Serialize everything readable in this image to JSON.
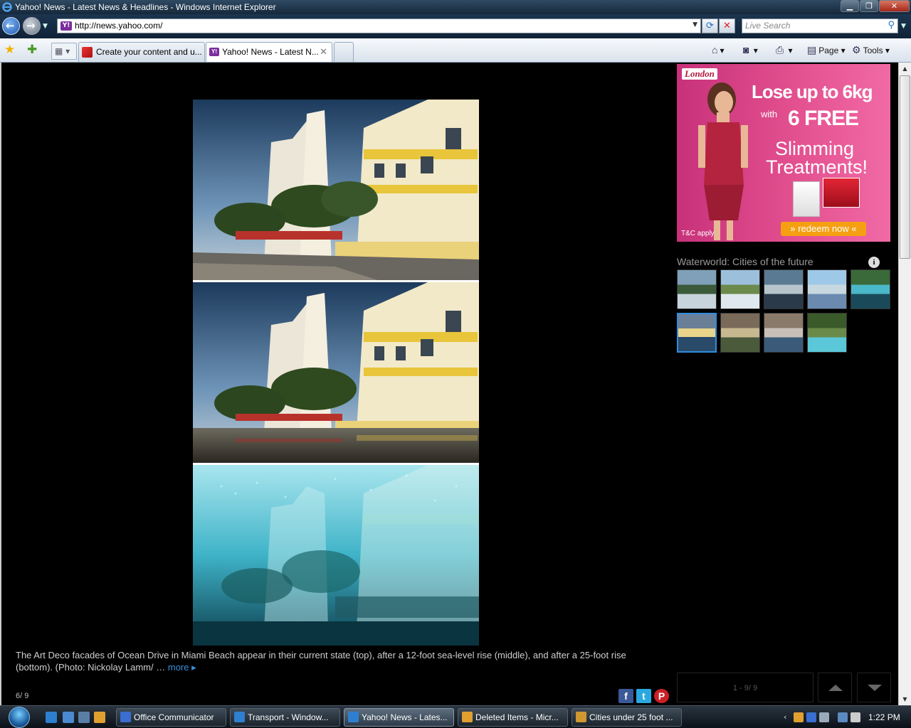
{
  "window": {
    "title": "Yahoo! News - Latest News & Headlines - Windows Internet Explorer",
    "minimize": "▁",
    "maximize": "❐",
    "close": "✕"
  },
  "navbar": {
    "back_icon": "←",
    "forward_icon": "→",
    "address": "http://news.yahoo.com/",
    "favicon": "Y!",
    "search_placeholder": "Live Search",
    "refresh_icon": "⟳",
    "stop_icon": "✕"
  },
  "tabs": [
    {
      "label": "Create your content and u..."
    },
    {
      "label": "Yahoo! News - Latest N..."
    }
  ],
  "commands": {
    "page": "Page",
    "tools": "Tools"
  },
  "slideshow": {
    "caption": "The Art Deco facades of Ocean Drive in Miami Beach appear in their current state (top), after a 12-foot sea-level rise (middle), and after a 25-foot rise (bottom). (Photo: Nickolay Lamm/ …",
    "more": "more",
    "counter": "6/ 9",
    "pager": "1 - 9/ 9",
    "social": {
      "facebook": "f",
      "twitter": "t",
      "pinterest": "P"
    }
  },
  "ad": {
    "brand": "London",
    "line1": "Lose up to 6kg",
    "line2": "with",
    "line3": "6 FREE",
    "line4": "Slimming",
    "line5": "Treatments!",
    "tc": "T&C apply",
    "cta": "» redeem now «"
  },
  "gallery": {
    "title": "Waterworld: Cities of the future",
    "info_icon": "i",
    "selected_index": 5,
    "thumb_count": 9
  },
  "taskbar": {
    "items": [
      {
        "label": "Office Communicator"
      },
      {
        "label": "Transport - Window..."
      },
      {
        "label": "Yahoo! News - Lates..."
      },
      {
        "label": "Deleted Items - Micr..."
      },
      {
        "label": "Cities under 25 foot ..."
      }
    ],
    "clock": "1:22 PM"
  },
  "colors": {
    "page_bg": "#000000",
    "link_blue": "#3a8fd8",
    "selected_thumb": "#2f8ce0",
    "ad_pink": "#e3508f",
    "ad_button": "#f5a012"
  }
}
